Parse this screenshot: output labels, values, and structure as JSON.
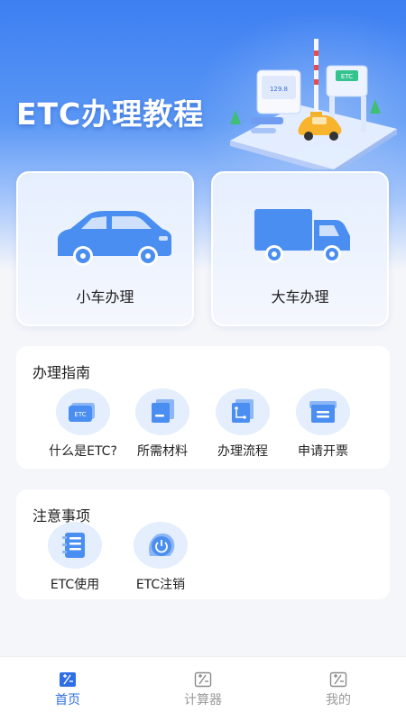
{
  "hero": {
    "title": "ETC办理教程",
    "illustration_sign": "ETC",
    "illustration_screen": "129.8"
  },
  "vehicles": [
    {
      "label": "小车办理",
      "icon": "car-icon"
    },
    {
      "label": "大车办理",
      "icon": "truck-icon"
    }
  ],
  "guide": {
    "title": "办理指南",
    "items": [
      {
        "label": "什么是ETC?",
        "icon": "etc-card-icon",
        "badge": "ETC"
      },
      {
        "label": "所需材料",
        "icon": "documents-icon"
      },
      {
        "label": "办理流程",
        "icon": "flow-icon"
      },
      {
        "label": "申请开票",
        "icon": "invoice-icon"
      }
    ]
  },
  "notes": {
    "title": "注意事项",
    "items": [
      {
        "label": "ETC使用",
        "icon": "notebook-icon"
      },
      {
        "label": "ETC注销",
        "icon": "power-icon"
      }
    ]
  },
  "tabs": [
    {
      "label": "首页",
      "icon": "home-calc-icon",
      "active": true
    },
    {
      "label": "计算器",
      "icon": "calculator-icon",
      "active": false
    },
    {
      "label": "我的",
      "icon": "profile-calc-icon",
      "active": false
    }
  ],
  "colors": {
    "primary": "#2f6fe6",
    "icon_blue": "#4a8ef2",
    "icon_bg": "#e4eefc",
    "inactive": "#9a9a9a"
  }
}
